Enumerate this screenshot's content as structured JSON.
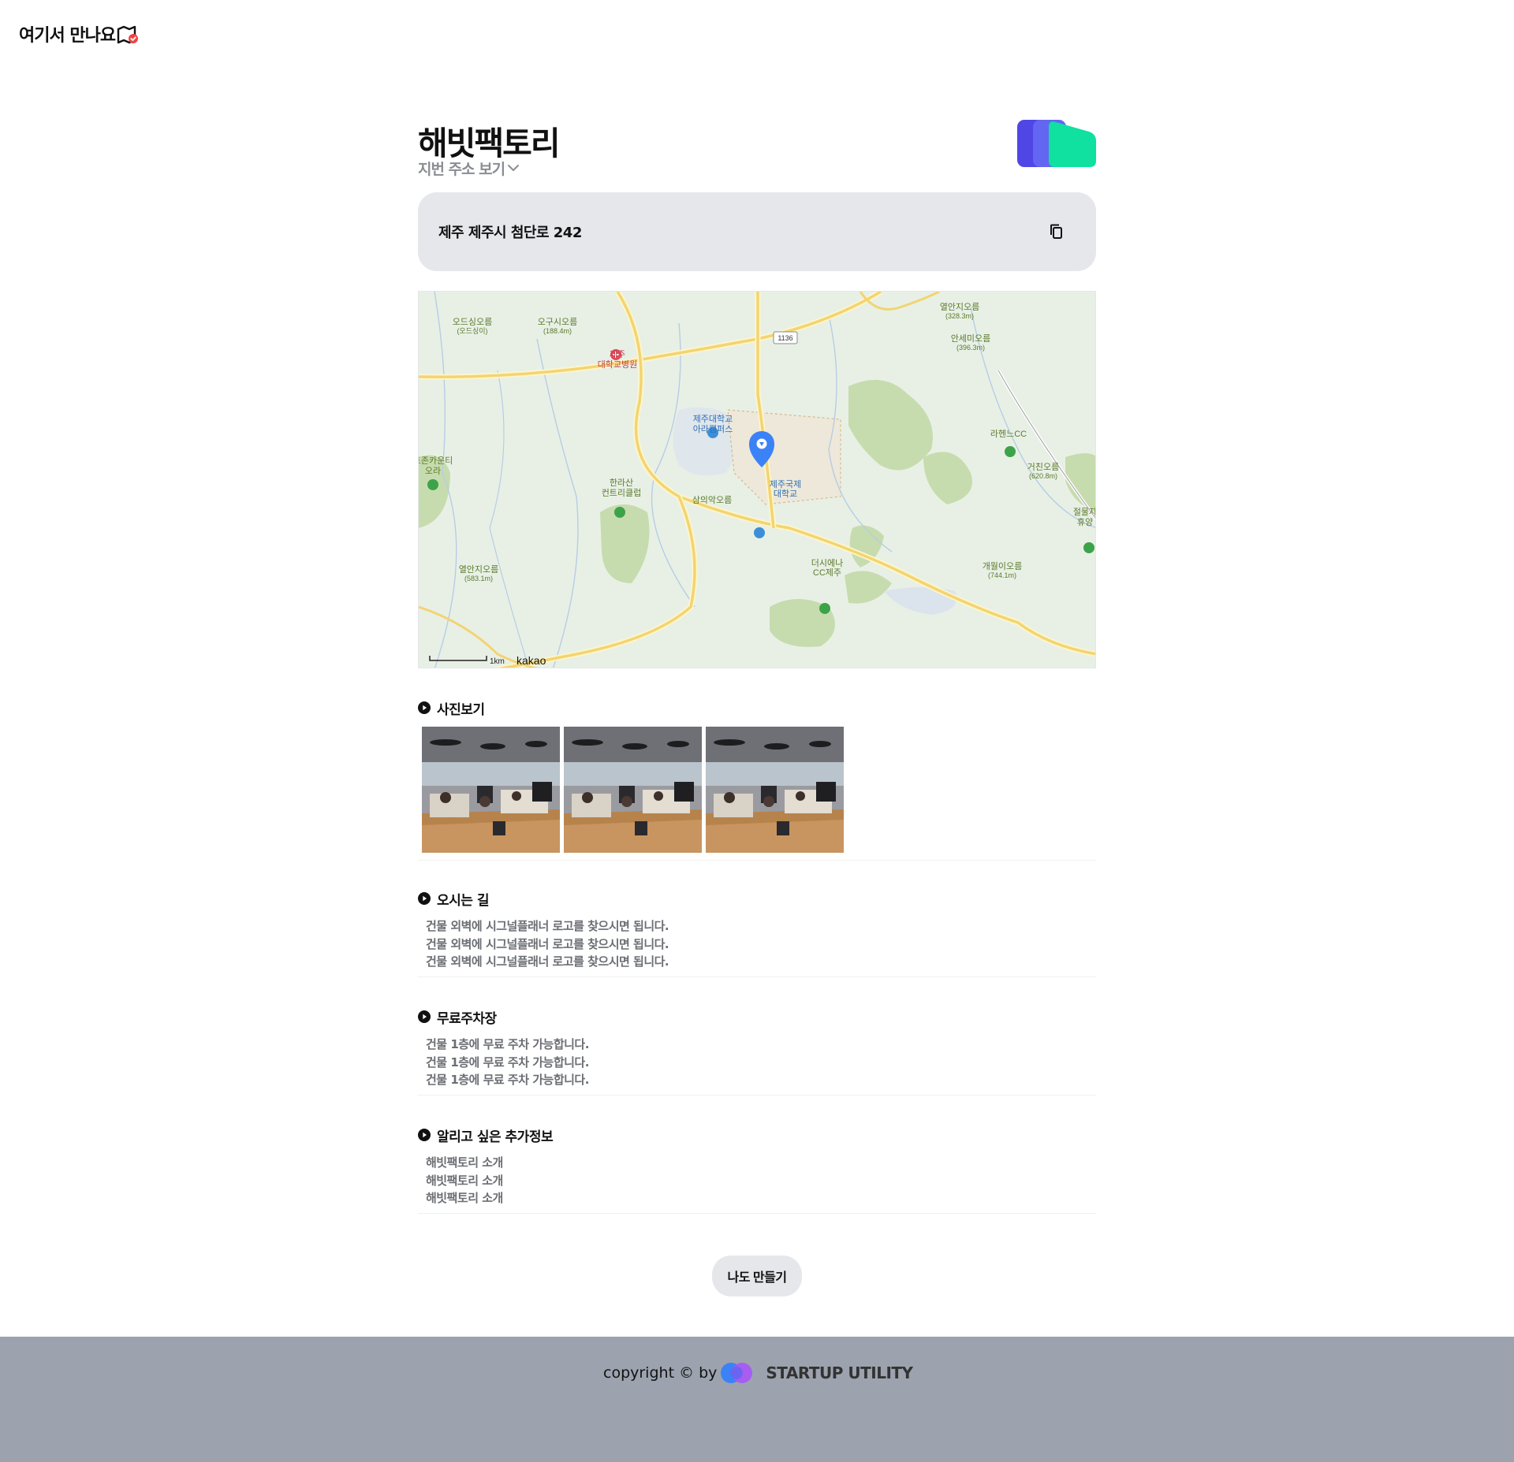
{
  "header": {
    "logo_text": "여기서 만나요",
    "logo_icon": "map-check-icon",
    "accent_color": "#ef4444"
  },
  "place": {
    "name": "해빗팩토리",
    "jibun_toggle_label": "지번 주소 보기",
    "address": "제주 제주시 첨단로 242",
    "copy_icon": "copy-icon"
  },
  "map": {
    "provider_label": "kakao",
    "scale_label": "1km",
    "labels": [
      "오드싱오름",
      "(오드싱이)",
      "오구시오름",
      "(188.4m)",
      "열안지오름",
      "(328.3m)",
      "안세미오름",
      "(396.3m)",
      "1136",
      "제주",
      "대학교병원",
      "제주대학교",
      "아라캠퍼스",
      "라헨느CC",
      "거친오름",
      "(620.8m)",
      "토존카운티",
      "오라",
      "한라산",
      "컨트리클럽",
      "제주국제",
      "대학교",
      "삼의악오름",
      "절물자",
      "휴양",
      "더시에나",
      "CC제주",
      "열안지오름",
      "(583.1m)",
      "개월이오름",
      "(744.1m)"
    ]
  },
  "sections": {
    "photos": {
      "title": "사진보기",
      "count": 3
    },
    "directions": {
      "title": "오시는 길",
      "lines": [
        "건물 외벽에 시그널플래너 로고를 찾으시면 됩니다.",
        "건물 외벽에 시그널플래너 로고를 찾으시면 됩니다.",
        "건물 외벽에 시그널플래너 로고를 찾으시면 됩니다."
      ]
    },
    "parking": {
      "title": "무료주차장",
      "lines": [
        "건물 1층에 무료 주차 가능합니다.",
        "건물 1층에 무료 주차 가능합니다.",
        "건물 1층에 무료 주차 가능합니다."
      ]
    },
    "extra": {
      "title": "알리고 싶은 추가정보",
      "lines": [
        "해빗팩토리 소개",
        "해빗팩토리 소개",
        "해빗팩토리 소개"
      ]
    }
  },
  "make_button_label": "나도 만들기",
  "footer": {
    "copyright": "copyright ©  by",
    "brand": "STARTUP UTILITY"
  },
  "colors": {
    "footer_bg": "#9ca3af",
    "address_bg": "#e5e7eb",
    "marker_blue": "#3b82f6",
    "brand_green": "#10e0a0",
    "brand_indigo": "#4f46e5"
  }
}
